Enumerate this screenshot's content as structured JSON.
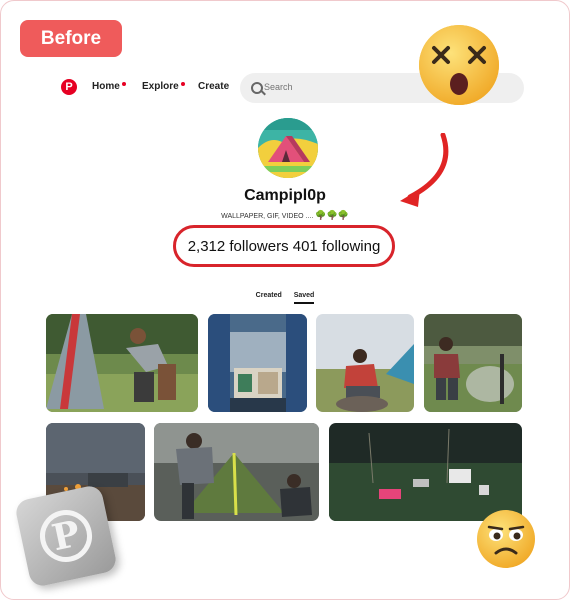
{
  "badge": {
    "label": "Before"
  },
  "nav": {
    "logo_icon": "pinterest-logo-icon",
    "home_label": "Home",
    "explore_label": "Explore",
    "create_label": "Create",
    "search_placeholder": "Search"
  },
  "profile": {
    "name": "Campipl0p",
    "bio": "WALLPAPER, GIF, VIDEO ....",
    "bio_emojis": "🌳🌳🌳",
    "stats": "2,312 followers 401 following"
  },
  "tabs": [
    {
      "label": "Created",
      "active": false
    },
    {
      "label": "Saved",
      "active": true
    }
  ],
  "colors": {
    "accent": "#e60023",
    "badge": "#ef5b5b",
    "highlight": "#d8242b"
  },
  "decorations": [
    "dizzy-face-emoji",
    "worried-face-emoji",
    "red-arrow",
    "pinterest-3d-badge"
  ]
}
